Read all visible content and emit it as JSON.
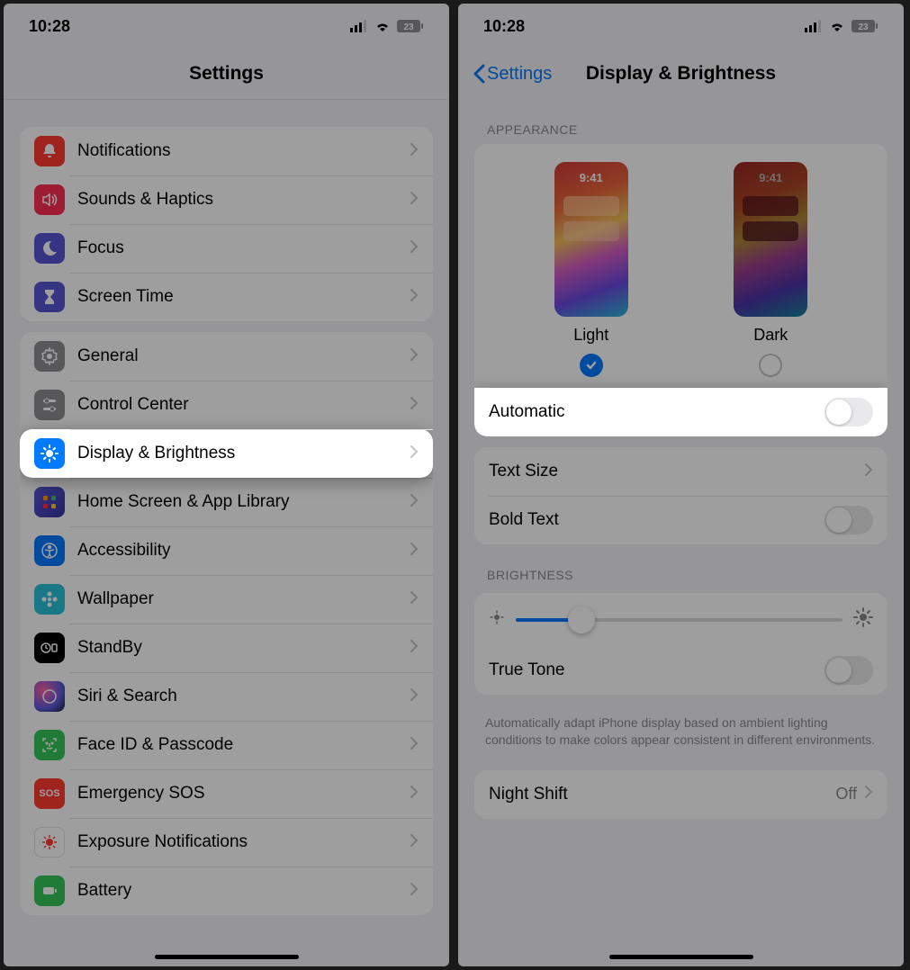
{
  "status": {
    "time": "10:28",
    "battery": "23"
  },
  "left": {
    "title": "Settings",
    "group1": [
      {
        "label": "Notifications",
        "icon": "bell",
        "color": "#ff3b30"
      },
      {
        "label": "Sounds & Haptics",
        "icon": "speaker",
        "color": "#ff2d55"
      },
      {
        "label": "Focus",
        "icon": "moon",
        "color": "#5856d6"
      },
      {
        "label": "Screen Time",
        "icon": "hourglass",
        "color": "#5856d6"
      }
    ],
    "group2": [
      {
        "label": "General",
        "icon": "gear",
        "color": "#8e8e93"
      },
      {
        "label": "Control Center",
        "icon": "sliders",
        "color": "#8e8e93"
      },
      {
        "label": "Display & Brightness",
        "icon": "sun",
        "color": "#007aff",
        "highlight": true
      },
      {
        "label": "Home Screen & App Library",
        "icon": "grid",
        "color": "#3f3fbf"
      },
      {
        "label": "Accessibility",
        "icon": "person",
        "color": "#007aff"
      },
      {
        "label": "Wallpaper",
        "icon": "flower",
        "color": "#28c2d8"
      },
      {
        "label": "StandBy",
        "icon": "clock",
        "color": "#000000"
      },
      {
        "label": "Siri & Search",
        "icon": "siri",
        "color": "#222222"
      },
      {
        "label": "Face ID & Passcode",
        "icon": "faceid",
        "color": "#34c759"
      },
      {
        "label": "Emergency SOS",
        "icon": "sos",
        "color": "#ff3b30"
      },
      {
        "label": "Exposure Notifications",
        "icon": "virus",
        "color": "#ffffff"
      },
      {
        "label": "Battery",
        "icon": "battery",
        "color": "#34c759"
      }
    ]
  },
  "right": {
    "back_label": "Settings",
    "title": "Display & Brightness",
    "appearance_header": "APPEARANCE",
    "preview_time": "9:41",
    "light_label": "Light",
    "dark_label": "Dark",
    "selected_mode": "light",
    "automatic_label": "Automatic",
    "automatic_on": false,
    "text_size_label": "Text Size",
    "bold_text_label": "Bold Text",
    "bold_text_on": false,
    "brightness_header": "BRIGHTNESS",
    "brightness_value": 0.2,
    "true_tone_label": "True Tone",
    "true_tone_on": false,
    "true_tone_footer": "Automatically adapt iPhone display based on ambient lighting conditions to make colors appear consistent in different environments.",
    "night_shift_label": "Night Shift",
    "night_shift_value": "Off"
  }
}
